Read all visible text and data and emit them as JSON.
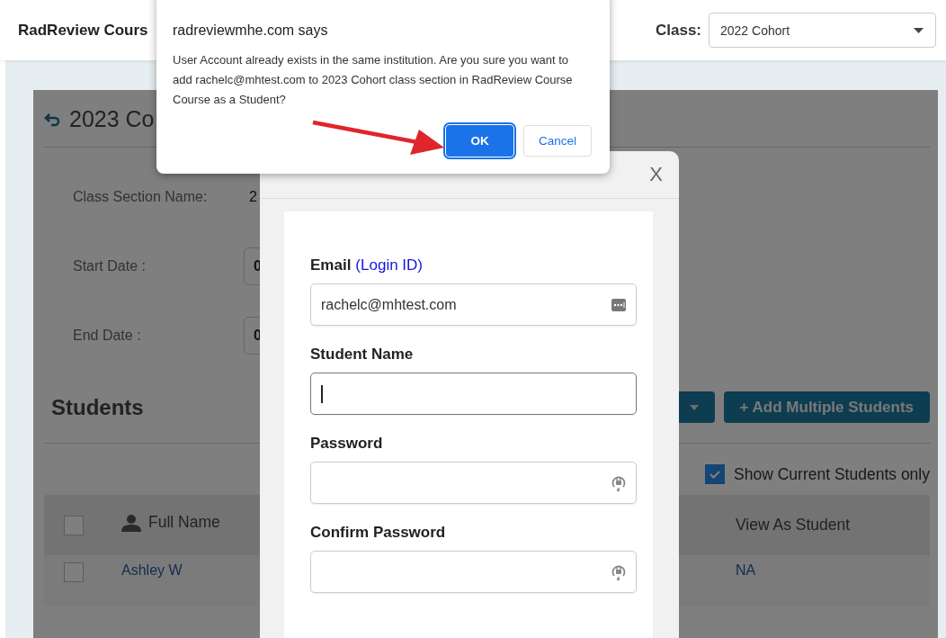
{
  "header": {
    "app_title": "RadReview Cours",
    "class_label": "Class:",
    "class_select": "2022 Cohort"
  },
  "page": {
    "title": "2023 Co",
    "details": [
      {
        "label": "Class Section Name:",
        "value": "2",
        "kind": "text"
      },
      {
        "label": "Start Date :",
        "value": "0",
        "kind": "date"
      },
      {
        "label": "End Date :",
        "value": "0",
        "kind": "date"
      }
    ]
  },
  "students": {
    "heading": "Students",
    "add_multiple_button": "+ Add Multiple Students",
    "filter": {
      "label": "Show Current Students only",
      "checked": true
    },
    "table": {
      "select_all_checked": false,
      "columns": [
        "Full Name",
        "View As Student"
      ],
      "rows": [
        {
          "checked": false,
          "full_name": "Ashley W",
          "view_as_student": "NA"
        }
      ]
    }
  },
  "modal": {
    "close": "X",
    "fields": [
      {
        "label": "Email",
        "label_note": "(Login ID)",
        "value": "rachelc@mhtest.com",
        "kind": "email",
        "focused": false
      },
      {
        "label": "Student Name",
        "kind": "text",
        "focused": true
      },
      {
        "label": "Password",
        "kind": "password",
        "focused": false
      },
      {
        "label": "Confirm Password",
        "kind": "password",
        "focused": false
      }
    ]
  },
  "alert": {
    "title": "radreviewmhe.com says",
    "message": "User Account already exists in the same institution. Are you sure you want to add rachelc@mhtest.com to 2023 Cohort class section in RadReview Course Course as a Student?",
    "buttons": [
      {
        "label": "OK",
        "kind": "primary"
      },
      {
        "label": "Cancel",
        "kind": "secondary"
      }
    ]
  }
}
